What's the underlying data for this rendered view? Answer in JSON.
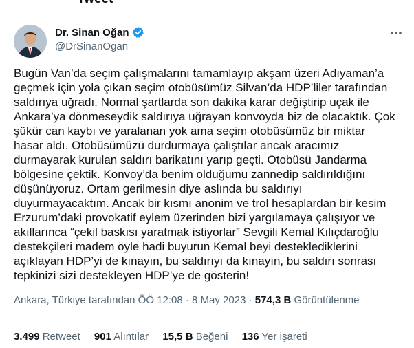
{
  "header": {
    "title": "Tweet"
  },
  "author": {
    "name": "Dr. Sinan Oğan",
    "handle": "@DrSinanOgan",
    "verified_color": "#1d9bf0"
  },
  "tweet": {
    "text": "Bugün Van’da seçim çalışmalarını tamamlayıp akşam üzeri Adıyaman’a\ngeçmek için yola çıkan seçim otobüsümüz Silvan’da HDP’liler tarafından\nsaldırıya uğradı. Normal şartlarda son dakika karar değiştirip uçak ile\nAnkara’ya dönmeseydik saldırıya uğrayan konvoyda biz de olacaktık. Çok\nşükür can kaybı ve yaralanan yok ama seçim otobüsümüz bir miktar\nhasar aldı. Otobüsümüzü durdurmaya çalıştılar ancak aracımız\ndurmayarak kurulan saldırı barikatını yarıp geçti. Otobüsü Jandarma\nbölgesine çektik. Konvoy’da benim olduğumu zannedip saldırıldığını\ndüşünüyoruz. Ortam gerilmesin diye aslında bu saldırıyı\nduyurmayacaktım. Ancak bir kısmı anonim ve trol hesaplardan bir kesim\nErzurum’daki provokatif eylem üzerinden bizi yargılamaya çalışıyor ve\nakıllarınca “çekil baskısı yaratmak istiyorlar” Sevgili Kemal Kılıçdaroğlu\ndestekçileri madem öyle hadi buyurun Kemal beyi desteklediklerini\naçıklayan HDP’yi de kınayın, bu saldırıyı da kınayın, bu saldırı sonrası\ntepkinizi sizi destekleyen HDP’ye de gösterin!",
    "location_time": "Ankara, Türkiye tarafından ÖÖ 12:08 · 8 May 2023 · ",
    "views_count": "574,3 B",
    "views_label": " Görüntülenme"
  },
  "stats": {
    "retweets_count": "3.499",
    "retweets_label": "Retweet",
    "quotes_count": "901",
    "quotes_label": "Alıntılar",
    "likes_count": "15,5 B",
    "likes_label": "Beğeni",
    "bookmarks_count": "136",
    "bookmarks_label": "Yer işareti"
  },
  "icons": {
    "more": "more-dots-icon",
    "verified": "verified-badge-icon"
  }
}
